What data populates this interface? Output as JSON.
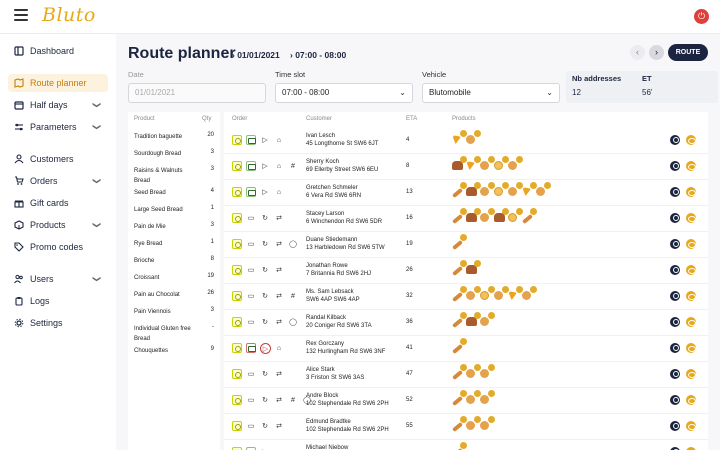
{
  "app": {
    "logo_text": "Bluto"
  },
  "colors": {
    "accent": "#e8a817",
    "navy": "#1c2540",
    "active_bg": "#fdf2de",
    "power": "#e0403a"
  },
  "sidebar": {
    "items": [
      {
        "label": "Dashboard",
        "icon": "columns-icon",
        "chevron": ""
      },
      {
        "label": "Route planner",
        "icon": "map-icon",
        "chevron": "",
        "active": true
      },
      {
        "label": "Half days",
        "icon": "calendar-icon",
        "chevron": "❯"
      },
      {
        "label": "Parameters",
        "icon": "sliders-icon",
        "chevron": "❯"
      },
      {
        "label": "Customers",
        "icon": "user-icon",
        "chevron": ""
      },
      {
        "label": "Orders",
        "icon": "cart-icon",
        "chevron": "❯"
      },
      {
        "label": "Gift cards",
        "icon": "gift-icon",
        "chevron": ""
      },
      {
        "label": "Products",
        "icon": "box-icon",
        "chevron": "❯"
      },
      {
        "label": "Promo codes",
        "icon": "tag-icon",
        "chevron": ""
      },
      {
        "label": "Users",
        "icon": "users-icon",
        "chevron": "❯"
      },
      {
        "label": "Logs",
        "icon": "clipboard-icon",
        "chevron": ""
      },
      {
        "label": "Settings",
        "icon": "gear-icon",
        "chevron": ""
      }
    ]
  },
  "header": {
    "title": "Route planner",
    "crumb_date": "01/01/2021",
    "crumb_slot": "07:00 - 08:00",
    "prev": "‹",
    "next": "›",
    "route_button": "ROUTE"
  },
  "filters": {
    "date_label": "Date",
    "date_placeholder": "01/01/2021",
    "timeslot_label": "Time slot",
    "timeslot_value": "07:00 - 08:00",
    "vehicle_label": "Vehicle",
    "vehicle_value": "Blutomobile",
    "nb_addresses_label": "Nb addresses",
    "nb_addresses_value": "12",
    "et_label": "ET",
    "et_value": "56'"
  },
  "products_table": {
    "headers": {
      "product": "Product",
      "qty": "Qty"
    },
    "rows": [
      {
        "name": "Tradition baguette",
        "qty": "20"
      },
      {
        "name": "Sourdough Bread",
        "qty": "3"
      },
      {
        "name": "Raisins & Walnuts Bread",
        "qty": "3"
      },
      {
        "name": "Seed Bread",
        "qty": "4"
      },
      {
        "name": "Large Seed Bread",
        "qty": "1"
      },
      {
        "name": "Pain de Mie",
        "qty": "3"
      },
      {
        "name": "Rye Bread",
        "qty": "1"
      },
      {
        "name": "Brioche",
        "qty": "8"
      },
      {
        "name": "Croissant",
        "qty": "19"
      },
      {
        "name": "Pain au Chocolat",
        "qty": "26"
      },
      {
        "name": "Pain Viennois",
        "qty": "3"
      },
      {
        "name": "Individual Gluten free Bread",
        "qty": "-"
      },
      {
        "name": "Chouquettes",
        "qty": "9"
      }
    ]
  },
  "route_table": {
    "headers": {
      "order": "Order",
      "customer": "Customer",
      "eta": "ETA",
      "products": "Products"
    },
    "rows": [
      {
        "name": "Ivan Lesch",
        "address": "45 Longthorne St SW6 6JT",
        "eta": "4",
        "order": [
          "sun",
          "pay",
          "play",
          "home"
        ],
        "products": [
          "pizza",
          "croissant"
        ]
      },
      {
        "name": "Sherry Koch",
        "address": "69 Ellerby Street SW6 6EU",
        "eta": "8",
        "order": [
          "sun",
          "pay",
          "play",
          "home",
          "hash"
        ],
        "products": [
          "loaf",
          "pizza",
          "croissant",
          "bun",
          "croissant"
        ]
      },
      {
        "name": "Gretchen Schmeler",
        "address": "6 Vera Rd SW6 6RN",
        "eta": "13",
        "order": [
          "sun",
          "pay",
          "play",
          "home"
        ],
        "products": [
          "baguette",
          "loaf",
          "croissant",
          "bun",
          "croissant",
          "pizza",
          "croissant"
        ]
      },
      {
        "name": "Stacey Larson",
        "address": "6 Winchendon Rd SW6 5DR",
        "eta": "16",
        "order": [
          "sun",
          "card",
          "refresh",
          "arrows"
        ],
        "products": [
          "baguette",
          "loaf",
          "croissant",
          "loaf",
          "bun",
          "baguette"
        ]
      },
      {
        "name": "Duane Stiedemann",
        "address": "13 Harbledown Rd SW6 5TW",
        "eta": "19",
        "order": [
          "sun",
          "card",
          "refresh",
          "arrows",
          "chat"
        ],
        "products": [
          "baguette"
        ]
      },
      {
        "name": "Jonathan Rowe",
        "address": "7 Britannia Rd SW6 2HJ",
        "eta": "26",
        "order": [
          "sun",
          "card",
          "refresh",
          "arrows"
        ],
        "products": [
          "baguette",
          "loaf"
        ]
      },
      {
        "name": "Ms. Sam Lebsack",
        "address": "SW6 4AP SW6 4AP",
        "eta": "32",
        "order": [
          "sun",
          "card",
          "refresh",
          "arrows",
          "hash"
        ],
        "products": [
          "baguette",
          "croissant",
          "bun",
          "croissant",
          "pizza",
          "croissant"
        ]
      },
      {
        "name": "Randal Kilback",
        "address": "20 Coniger Rd SW6 3TA",
        "eta": "36",
        "order": [
          "sun",
          "card",
          "refresh",
          "arrows",
          "chat"
        ],
        "products": [
          "baguette",
          "loaf",
          "croissant"
        ]
      },
      {
        "name": "Rex Gorczany",
        "address": "132 Hurlingham Rd SW6 3NF",
        "eta": "41",
        "order": [
          "sun",
          "payred",
          "playred",
          "home"
        ],
        "products": [
          "baguette"
        ]
      },
      {
        "name": "Alice Stark",
        "address": "3 Friston St SW6 3AS",
        "eta": "47",
        "order": [
          "sun",
          "card",
          "refresh",
          "arrows"
        ],
        "products": [
          "baguette",
          "croissant",
          "croissant"
        ]
      },
      {
        "name": "Andre Block",
        "address": "102 Stephendale Rd SW6 2PH",
        "eta": "52",
        "order": [
          "sun",
          "card",
          "refresh",
          "arrows",
          "hash",
          "chat"
        ],
        "products": [
          "baguette",
          "croissant",
          "croissant"
        ]
      },
      {
        "name": "Edmund Bradtke",
        "address": "102 Stephendale Rd SW6 2PH",
        "eta": "55",
        "order": [
          "sun",
          "card",
          "refresh",
          "arrows"
        ],
        "products": [
          "baguette",
          "croissant",
          "croissant"
        ]
      },
      {
        "name": "Michael Niebow",
        "address": "",
        "eta": "",
        "order": [
          "sun",
          "pay",
          "play",
          "home"
        ],
        "products": [
          "baguette"
        ]
      }
    ]
  }
}
